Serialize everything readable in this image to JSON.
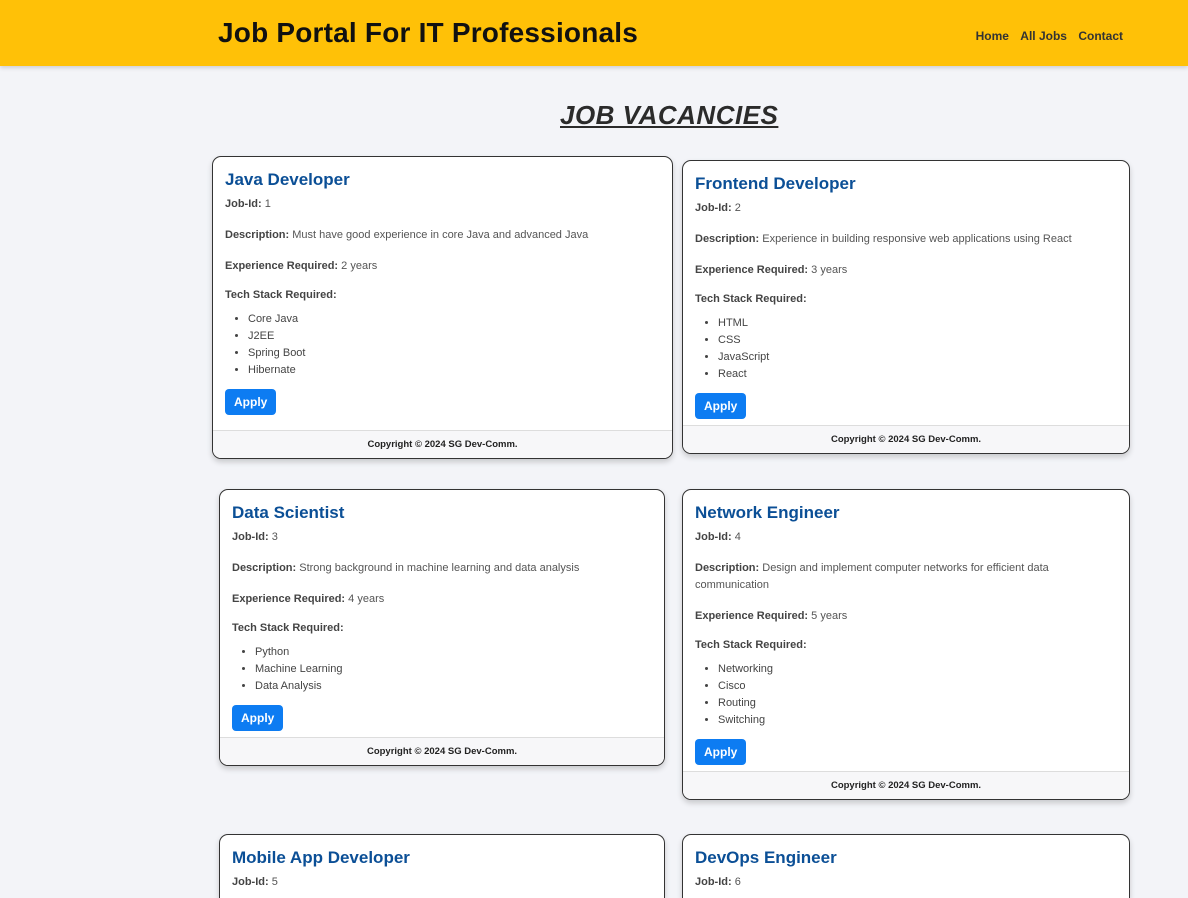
{
  "header": {
    "brand": "Job Portal For IT Professionals",
    "nav": [
      "Home",
      "All Jobs",
      "Contact"
    ]
  },
  "page": {
    "heading": "JOB VACANCIES"
  },
  "labels": {
    "job_id": "Job-Id:",
    "description": "Description:",
    "experience": "Experience Required:",
    "tech_stack": "Tech Stack Required:",
    "apply": "Apply",
    "footer": "Copyright © 2024 SG Dev-Comm."
  },
  "jobs": [
    {
      "title": "Java Developer",
      "id": "1",
      "description": "Must have good experience in core Java and advanced Java",
      "experience": "2 years",
      "tech": [
        "Core Java",
        "J2EE",
        "Spring Boot",
        "Hibernate"
      ]
    },
    {
      "title": "Frontend Developer",
      "id": "2",
      "description": "Experience in building responsive web applications using React",
      "experience": "3 years",
      "tech": [
        "HTML",
        "CSS",
        "JavaScript",
        "React"
      ]
    },
    {
      "title": "Data Scientist",
      "id": "3",
      "description": "Strong background in machine learning and data analysis",
      "experience": "4 years",
      "tech": [
        "Python",
        "Machine Learning",
        "Data Analysis"
      ]
    },
    {
      "title": "Network Engineer",
      "id": "4",
      "description": "Design and implement computer networks for efficient data communication",
      "experience": "5 years",
      "tech": [
        "Networking",
        "Cisco",
        "Routing",
        "Switching"
      ]
    },
    {
      "title": "Mobile App Developer",
      "id": "5",
      "description": "",
      "experience": "",
      "tech": []
    },
    {
      "title": "DevOps Engineer",
      "id": "6",
      "description": "",
      "experience": "",
      "tech": []
    }
  ]
}
